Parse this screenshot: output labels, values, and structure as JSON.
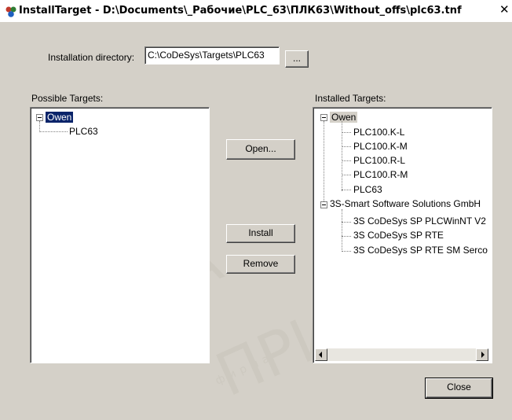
{
  "window": {
    "title": "InstallTarget - D:\\Documents\\_Рабочие\\PLC_63\\ПЛК63\\Without_offs\\plc63.tnf",
    "close_glyph": "✕"
  },
  "install_dir": {
    "label": "Installation directory:",
    "value": "C:\\CoDeSys\\Targets\\PLC63",
    "browse_label": "..."
  },
  "possible": {
    "label": "Possible Targets:",
    "tree": {
      "root": "Owen",
      "children": [
        "PLC63"
      ]
    }
  },
  "installed": {
    "label": "Installed Targets:",
    "groups": [
      {
        "name": "Owen",
        "children": [
          "PLC100.K-L",
          "PLC100.K-M",
          "PLC100.R-L",
          "PLC100.R-M",
          "PLC63"
        ]
      },
      {
        "name": "3S-Smart Software Solutions GmbH",
        "children": [
          "3S CoDeSys SP PLCWinNT V2",
          "3S CoDeSys SP RTE",
          "3S CoDeSys SP RTE SM Serco"
        ]
      }
    ]
  },
  "buttons": {
    "open": "Open...",
    "install": "Install",
    "remove": "Remove",
    "close": "Close"
  },
  "watermark": {
    "line1": "ПРИКА",
    "line2": "ПРИБОР",
    "line3": "фирма"
  },
  "colors": {
    "dialog_bg": "#d4d0c8",
    "selection": "#0a246a"
  }
}
